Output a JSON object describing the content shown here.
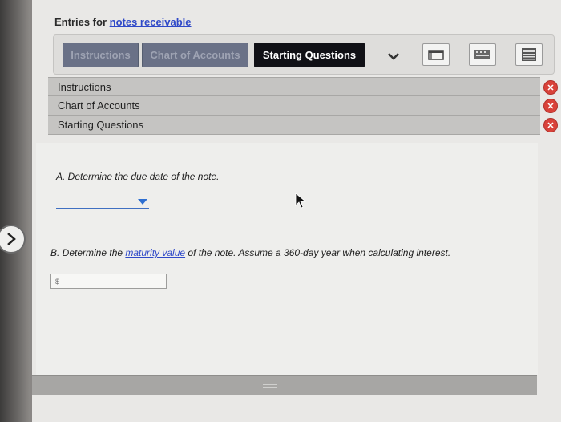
{
  "header": {
    "title_prefix": "Entries for",
    "title_link": "notes receivable"
  },
  "toolbar": {
    "tabs": [
      {
        "label": "Instructions",
        "state": "inactive"
      },
      {
        "label": "Chart of Accounts",
        "state": "inactive"
      },
      {
        "label": "Starting Questions",
        "state": "active"
      }
    ],
    "icons": [
      "chevron-down-icon",
      "window-icon",
      "keyboard-icon",
      "calculator-icon"
    ]
  },
  "open_panels": [
    {
      "label": "Instructions",
      "close_icon": "close-icon"
    },
    {
      "label": "Chart of Accounts",
      "close_icon": "close-icon"
    },
    {
      "label": "Starting Questions",
      "close_icon": "close-icon"
    }
  ],
  "questions": {
    "a": {
      "text": "A. Determine the due date of the note.",
      "select_value": ""
    },
    "b": {
      "prefix": "B. Determine the ",
      "link": "maturity value",
      "suffix": " of the note. Assume a 360-day year when calculating interest.",
      "currency_symbol": "$",
      "amount_value": ""
    }
  },
  "colors": {
    "link": "#2f49c8",
    "active_tab": "#111116",
    "inactive_tab": "#6a7187",
    "close_button": "#d9423a"
  }
}
